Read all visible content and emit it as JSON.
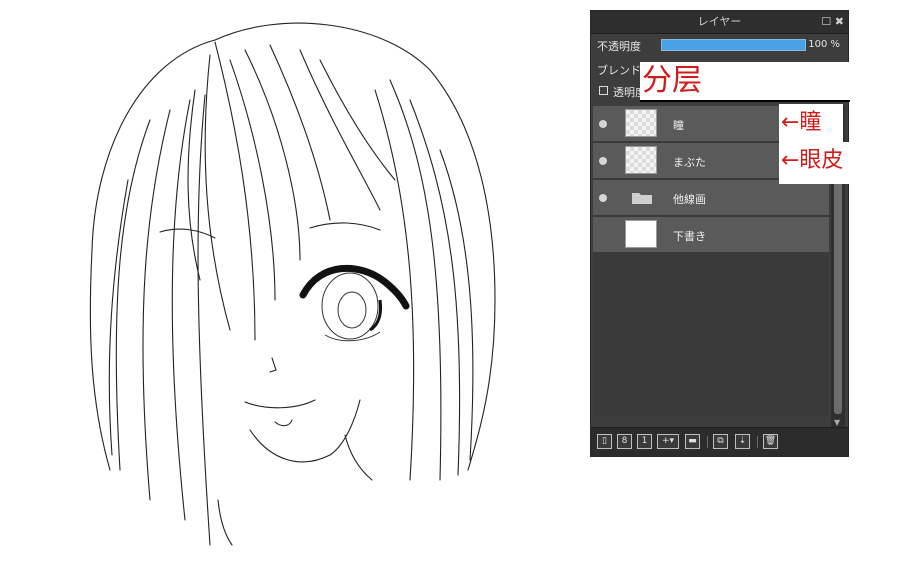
{
  "panel": {
    "title": "レイヤー",
    "title_icons": "☐ ✖",
    "opacity_label": "不透明度",
    "opacity_value": "100 %",
    "opacity_fraction": 1.0,
    "blend_label": "ブレンド",
    "clip_label": "透明度",
    "layers": [
      {
        "name": "瞳",
        "visible": true,
        "type": "layer"
      },
      {
        "name": "まぶた",
        "visible": true,
        "type": "layer"
      },
      {
        "name": "他線画",
        "visible": true,
        "type": "folder"
      },
      {
        "name": "下書き",
        "visible": false,
        "type": "sketch"
      }
    ],
    "toolbar": [
      "new-layer-icon",
      "new-8bit-layer-icon",
      "new-1bit-layer-icon",
      "add-layer-menu-icon",
      "folder-icon",
      "duplicate-icon",
      "merge-icon",
      "delete-icon"
    ]
  },
  "annotations": {
    "main": "分层",
    "layer1": "←瞳",
    "layer2": "←眼皮"
  },
  "colors": {
    "annotation": "#d01c1c",
    "opacity_bar": "#4aa2e6",
    "panel_bg": "#3d3d3d"
  }
}
